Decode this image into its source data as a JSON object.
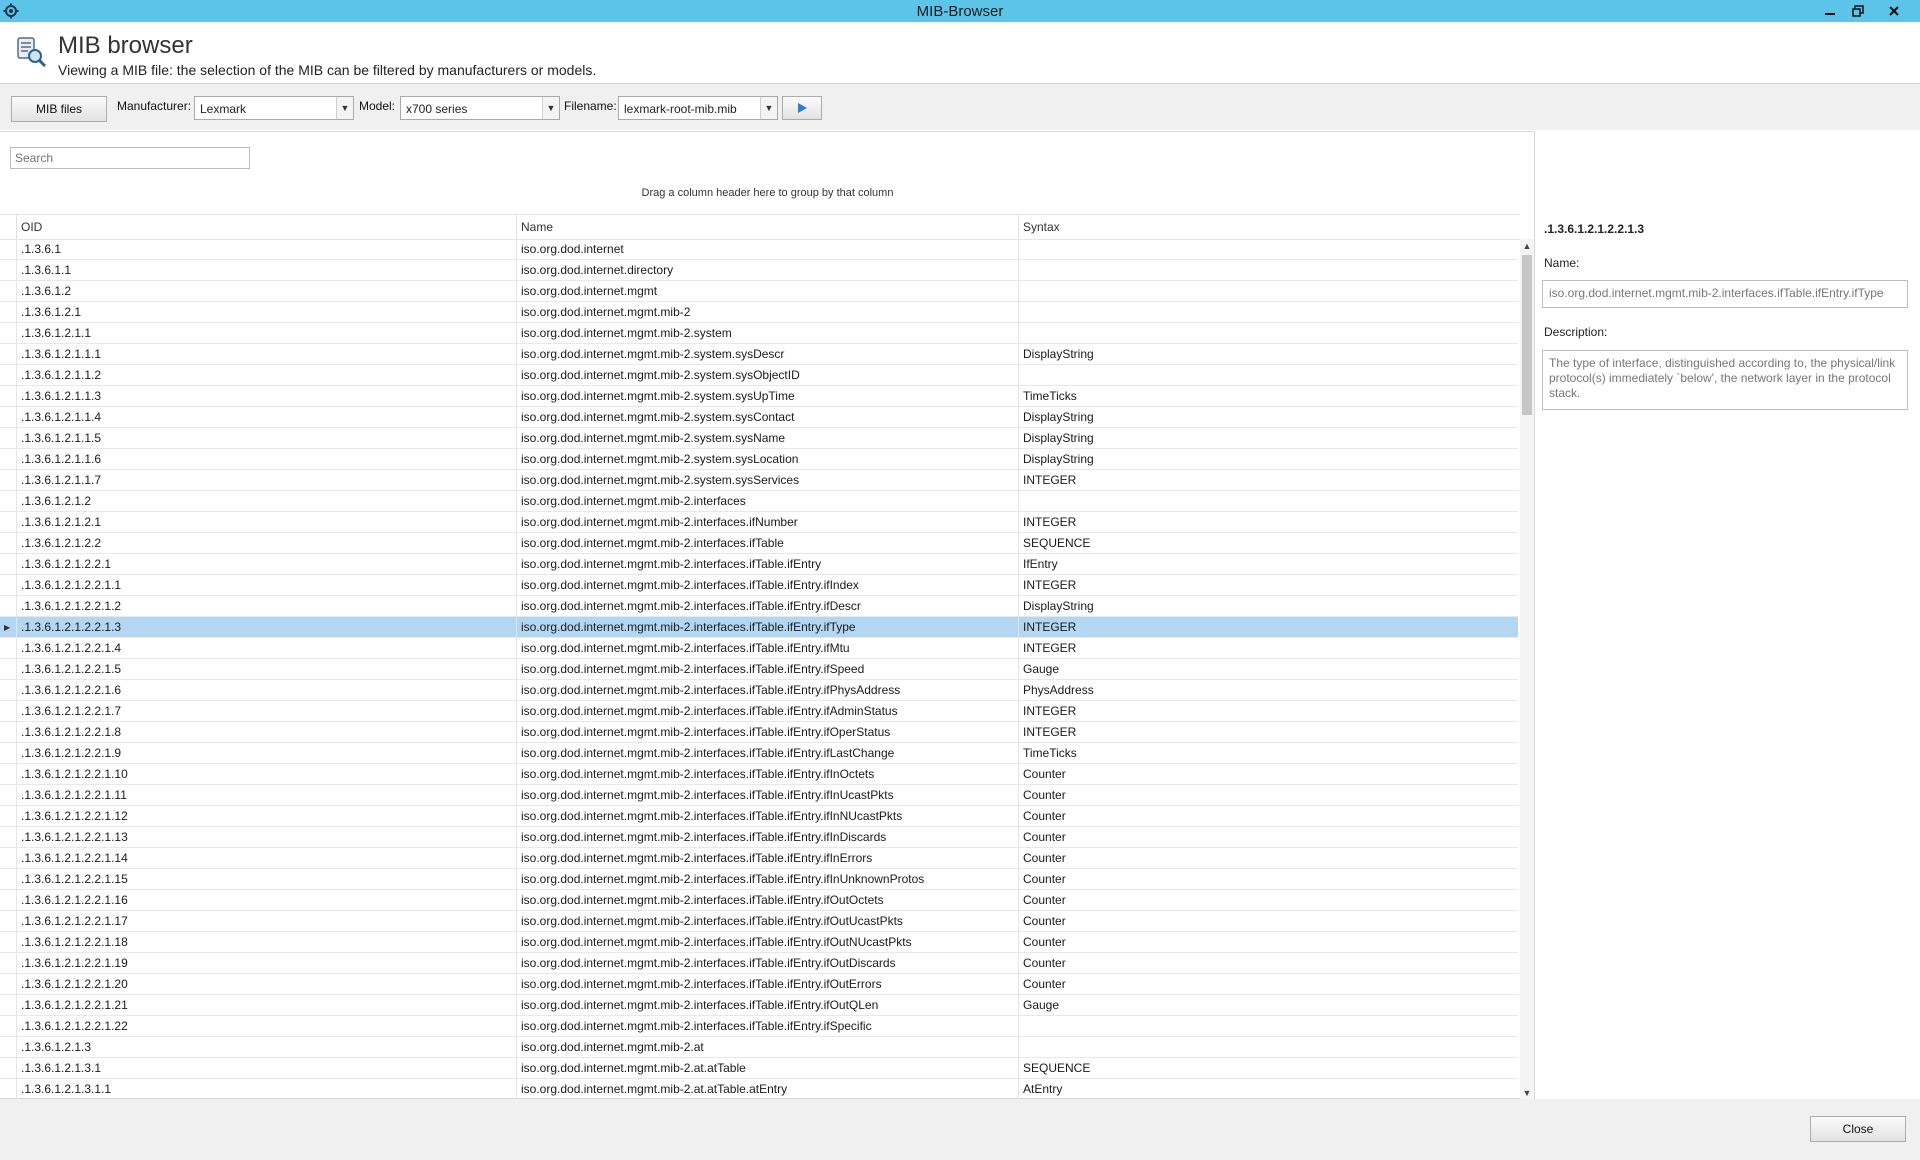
{
  "window": {
    "title": "MIB-Browser"
  },
  "header": {
    "title": "MIB browser",
    "subtitle": "Viewing a MIB file: the selection of the MIB can be filtered by manufacturers or models."
  },
  "toolbar": {
    "mib_files_label": "MIB files",
    "manufacturer_label": "Manufacturer:",
    "manufacturer_value": "Lexmark",
    "model_label": "Model:",
    "model_value": "x700 series",
    "filename_label": "Filename:",
    "filename_value": "lexmark-root-mib.mib",
    "play_icon": "play-icon"
  },
  "search": {
    "placeholder": "Search"
  },
  "grid": {
    "group_hint": "Drag a column header here to group by that column",
    "columns": [
      "OID",
      "Name",
      "Syntax"
    ],
    "selected_index": 18,
    "rows": [
      {
        "oid": ".1.3.6.1",
        "name": "iso.org.dod.internet",
        "syntax": ""
      },
      {
        "oid": ".1.3.6.1.1",
        "name": "iso.org.dod.internet.directory",
        "syntax": ""
      },
      {
        "oid": ".1.3.6.1.2",
        "name": "iso.org.dod.internet.mgmt",
        "syntax": ""
      },
      {
        "oid": ".1.3.6.1.2.1",
        "name": "iso.org.dod.internet.mgmt.mib-2",
        "syntax": ""
      },
      {
        "oid": ".1.3.6.1.2.1.1",
        "name": "iso.org.dod.internet.mgmt.mib-2.system",
        "syntax": ""
      },
      {
        "oid": ".1.3.6.1.2.1.1.1",
        "name": "iso.org.dod.internet.mgmt.mib-2.system.sysDescr",
        "syntax": "DisplayString"
      },
      {
        "oid": ".1.3.6.1.2.1.1.2",
        "name": "iso.org.dod.internet.mgmt.mib-2.system.sysObjectID",
        "syntax": ""
      },
      {
        "oid": ".1.3.6.1.2.1.1.3",
        "name": "iso.org.dod.internet.mgmt.mib-2.system.sysUpTime",
        "syntax": "TimeTicks"
      },
      {
        "oid": ".1.3.6.1.2.1.1.4",
        "name": "iso.org.dod.internet.mgmt.mib-2.system.sysContact",
        "syntax": "DisplayString"
      },
      {
        "oid": ".1.3.6.1.2.1.1.5",
        "name": "iso.org.dod.internet.mgmt.mib-2.system.sysName",
        "syntax": "DisplayString"
      },
      {
        "oid": ".1.3.6.1.2.1.1.6",
        "name": "iso.org.dod.internet.mgmt.mib-2.system.sysLocation",
        "syntax": "DisplayString"
      },
      {
        "oid": ".1.3.6.1.2.1.1.7",
        "name": "iso.org.dod.internet.mgmt.mib-2.system.sysServices",
        "syntax": "INTEGER"
      },
      {
        "oid": ".1.3.6.1.2.1.2",
        "name": "iso.org.dod.internet.mgmt.mib-2.interfaces",
        "syntax": ""
      },
      {
        "oid": ".1.3.6.1.2.1.2.1",
        "name": "iso.org.dod.internet.mgmt.mib-2.interfaces.ifNumber",
        "syntax": "INTEGER"
      },
      {
        "oid": ".1.3.6.1.2.1.2.2",
        "name": "iso.org.dod.internet.mgmt.mib-2.interfaces.ifTable",
        "syntax": "SEQUENCE"
      },
      {
        "oid": ".1.3.6.1.2.1.2.2.1",
        "name": "iso.org.dod.internet.mgmt.mib-2.interfaces.ifTable.ifEntry",
        "syntax": "IfEntry"
      },
      {
        "oid": ".1.3.6.1.2.1.2.2.1.1",
        "name": "iso.org.dod.internet.mgmt.mib-2.interfaces.ifTable.ifEntry.ifIndex",
        "syntax": "INTEGER"
      },
      {
        "oid": ".1.3.6.1.2.1.2.2.1.2",
        "name": "iso.org.dod.internet.mgmt.mib-2.interfaces.ifTable.ifEntry.ifDescr",
        "syntax": "DisplayString"
      },
      {
        "oid": ".1.3.6.1.2.1.2.2.1.3",
        "name": "iso.org.dod.internet.mgmt.mib-2.interfaces.ifTable.ifEntry.ifType",
        "syntax": "INTEGER"
      },
      {
        "oid": ".1.3.6.1.2.1.2.2.1.4",
        "name": "iso.org.dod.internet.mgmt.mib-2.interfaces.ifTable.ifEntry.ifMtu",
        "syntax": "INTEGER"
      },
      {
        "oid": ".1.3.6.1.2.1.2.2.1.5",
        "name": "iso.org.dod.internet.mgmt.mib-2.interfaces.ifTable.ifEntry.ifSpeed",
        "syntax": "Gauge"
      },
      {
        "oid": ".1.3.6.1.2.1.2.2.1.6",
        "name": "iso.org.dod.internet.mgmt.mib-2.interfaces.ifTable.ifEntry.ifPhysAddress",
        "syntax": "PhysAddress"
      },
      {
        "oid": ".1.3.6.1.2.1.2.2.1.7",
        "name": "iso.org.dod.internet.mgmt.mib-2.interfaces.ifTable.ifEntry.ifAdminStatus",
        "syntax": "INTEGER"
      },
      {
        "oid": ".1.3.6.1.2.1.2.2.1.8",
        "name": "iso.org.dod.internet.mgmt.mib-2.interfaces.ifTable.ifEntry.ifOperStatus",
        "syntax": "INTEGER"
      },
      {
        "oid": ".1.3.6.1.2.1.2.2.1.9",
        "name": "iso.org.dod.internet.mgmt.mib-2.interfaces.ifTable.ifEntry.ifLastChange",
        "syntax": "TimeTicks"
      },
      {
        "oid": ".1.3.6.1.2.1.2.2.1.10",
        "name": "iso.org.dod.internet.mgmt.mib-2.interfaces.ifTable.ifEntry.ifInOctets",
        "syntax": "Counter"
      },
      {
        "oid": ".1.3.6.1.2.1.2.2.1.11",
        "name": "iso.org.dod.internet.mgmt.mib-2.interfaces.ifTable.ifEntry.ifInUcastPkts",
        "syntax": "Counter"
      },
      {
        "oid": ".1.3.6.1.2.1.2.2.1.12",
        "name": "iso.org.dod.internet.mgmt.mib-2.interfaces.ifTable.ifEntry.ifInNUcastPkts",
        "syntax": "Counter"
      },
      {
        "oid": ".1.3.6.1.2.1.2.2.1.13",
        "name": "iso.org.dod.internet.mgmt.mib-2.interfaces.ifTable.ifEntry.ifInDiscards",
        "syntax": "Counter"
      },
      {
        "oid": ".1.3.6.1.2.1.2.2.1.14",
        "name": "iso.org.dod.internet.mgmt.mib-2.interfaces.ifTable.ifEntry.ifInErrors",
        "syntax": "Counter"
      },
      {
        "oid": ".1.3.6.1.2.1.2.2.1.15",
        "name": "iso.org.dod.internet.mgmt.mib-2.interfaces.ifTable.ifEntry.ifInUnknownProtos",
        "syntax": "Counter"
      },
      {
        "oid": ".1.3.6.1.2.1.2.2.1.16",
        "name": "iso.org.dod.internet.mgmt.mib-2.interfaces.ifTable.ifEntry.ifOutOctets",
        "syntax": "Counter"
      },
      {
        "oid": ".1.3.6.1.2.1.2.2.1.17",
        "name": "iso.org.dod.internet.mgmt.mib-2.interfaces.ifTable.ifEntry.ifOutUcastPkts",
        "syntax": "Counter"
      },
      {
        "oid": ".1.3.6.1.2.1.2.2.1.18",
        "name": "iso.org.dod.internet.mgmt.mib-2.interfaces.ifTable.ifEntry.ifOutNUcastPkts",
        "syntax": "Counter"
      },
      {
        "oid": ".1.3.6.1.2.1.2.2.1.19",
        "name": "iso.org.dod.internet.mgmt.mib-2.interfaces.ifTable.ifEntry.ifOutDiscards",
        "syntax": "Counter"
      },
      {
        "oid": ".1.3.6.1.2.1.2.2.1.20",
        "name": "iso.org.dod.internet.mgmt.mib-2.interfaces.ifTable.ifEntry.ifOutErrors",
        "syntax": "Counter"
      },
      {
        "oid": ".1.3.6.1.2.1.2.2.1.21",
        "name": "iso.org.dod.internet.mgmt.mib-2.interfaces.ifTable.ifEntry.ifOutQLen",
        "syntax": "Gauge"
      },
      {
        "oid": ".1.3.6.1.2.1.2.2.1.22",
        "name": "iso.org.dod.internet.mgmt.mib-2.interfaces.ifTable.ifEntry.ifSpecific",
        "syntax": ""
      },
      {
        "oid": ".1.3.6.1.2.1.3",
        "name": "iso.org.dod.internet.mgmt.mib-2.at",
        "syntax": ""
      },
      {
        "oid": ".1.3.6.1.2.1.3.1",
        "name": "iso.org.dod.internet.mgmt.mib-2.at.atTable",
        "syntax": "SEQUENCE"
      },
      {
        "oid": ".1.3.6.1.2.1.3.1.1",
        "name": "iso.org.dod.internet.mgmt.mib-2.at.atTable.atEntry",
        "syntax": "AtEntry"
      }
    ]
  },
  "detail": {
    "oid": ".1.3.6.1.2.1.2.2.1.3",
    "name_label": "Name:",
    "name_value": "iso.org.dod.internet.mgmt.mib-2.interfaces.ifTable.ifEntry.ifType",
    "description_label": "Description:",
    "description_value": "The type of interface, distinguished according to,  the physical/link protocol(s) immediately `below',  the network layer in the protocol stack."
  },
  "footer": {
    "close_label": "Close"
  },
  "colors": {
    "titlebar": "#5bc4e8",
    "selection": "#b3d7f3",
    "play": "#2a7fd4"
  }
}
